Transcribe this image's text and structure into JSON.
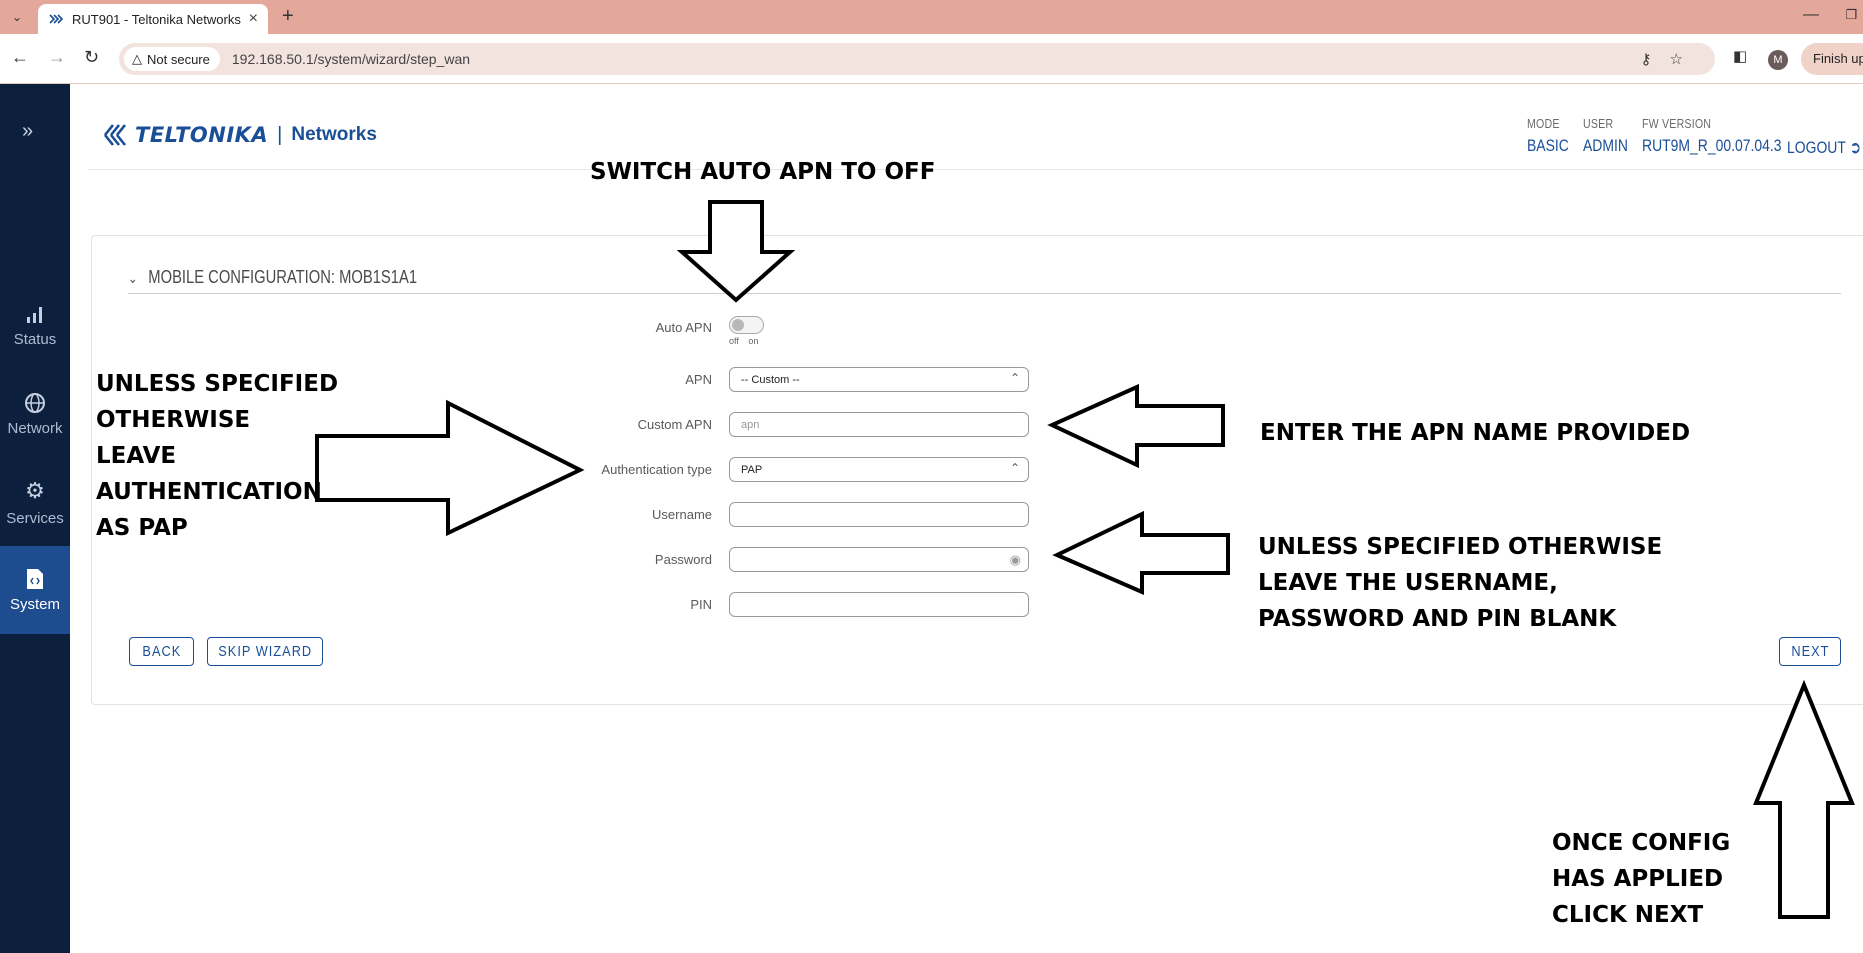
{
  "browser": {
    "tab_title": "RUT901 - Teltonika Networks",
    "not_secure_label": "Not secure",
    "url": "192.168.50.1/system/wizard/step_wan",
    "profile_initial": "M",
    "finish_update_label": "Finish upd"
  },
  "sidebar": {
    "items": [
      {
        "label": "Status",
        "icon": "signal-bars-icon"
      },
      {
        "label": "Network",
        "icon": "globe-icon"
      },
      {
        "label": "Services",
        "icon": "gear-icon"
      },
      {
        "label": "System",
        "icon": "code-file-icon"
      }
    ],
    "active": "System"
  },
  "header": {
    "brand": "TELTONIKA",
    "brand_suffix": "Networks",
    "separator": "|",
    "mode_label": "MODE",
    "mode_value": "BASIC",
    "user_label": "USER",
    "user_value": "ADMIN",
    "fw_label": "FW VERSION",
    "fw_value": "RUT9M_R_00.07.04.3",
    "logout": "LOGOUT"
  },
  "section": {
    "title": "MOBILE CONFIGURATION: MOB1S1A1"
  },
  "form": {
    "auto_apn_label": "Auto APN",
    "auto_apn_state": "off",
    "toggle_off": "off",
    "toggle_on": "on",
    "apn_label": "APN",
    "apn_value": "-- Custom --",
    "custom_apn_label": "Custom APN",
    "custom_apn_placeholder": "apn",
    "auth_label": "Authentication type",
    "auth_value": "PAP",
    "username_label": "Username",
    "username_value": "",
    "password_label": "Password",
    "password_value": "",
    "pin_label": "PIN",
    "pin_value": ""
  },
  "buttons": {
    "back": "BACK",
    "skip": "SKIP WIZARD",
    "next": "NEXT"
  },
  "annotations": {
    "switch_auto_apn": "SWITCH AUTO APN TO OFF",
    "auth_note": "UNLESS SPECIFIED\nOTHERWISE\nLEAVE\nAUTHENTICATION\nAS PAP",
    "apn_note": "ENTER THE APN NAME PROVIDED",
    "credentials_note": "UNLESS SPECIFIED OTHERWISE\nLEAVE THE USERNAME,\nPASSWORD AND PIN BLANK",
    "next_note": "ONCE CONFIG\nHAS APPLIED\nCLICK NEXT"
  },
  "colors": {
    "tabbar": "#e3a899",
    "sidebar": "#0c1f3d",
    "sidebar_active": "#1d4d8f",
    "brand": "#1a4f97"
  }
}
